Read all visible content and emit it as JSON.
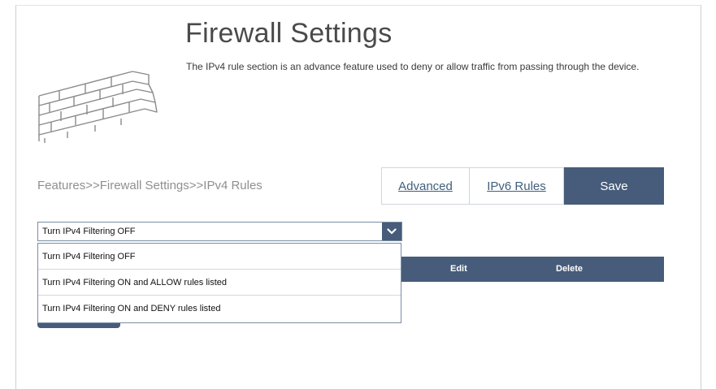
{
  "header": {
    "title": "Firewall Settings",
    "description": "The IPv4 rule section is an advance feature used to deny or allow traffic from passing through the device."
  },
  "breadcrumb": "Features>>Firewall Settings>>IPv4 Rules",
  "buttons": {
    "advanced": "Advanced",
    "ipv6_rules": "IPv6 Rules",
    "save": "Save"
  },
  "filter_select": {
    "selected": "Turn IPv4 Filtering OFF",
    "options": [
      "Turn IPv4 Filtering OFF",
      "Turn IPv4 Filtering ON and ALLOW rules listed",
      "Turn IPv4 Filtering ON and DENY rules listed"
    ]
  },
  "rules_table": {
    "columns": [
      "Edit",
      "Delete"
    ]
  },
  "colors": {
    "accent": "#465c7a",
    "link": "#3f5f7d",
    "breadcrumb": "#8f8f8f"
  },
  "icons": {
    "wall": "brick-wall-icon",
    "dropdown": "chevron-down-icon"
  }
}
